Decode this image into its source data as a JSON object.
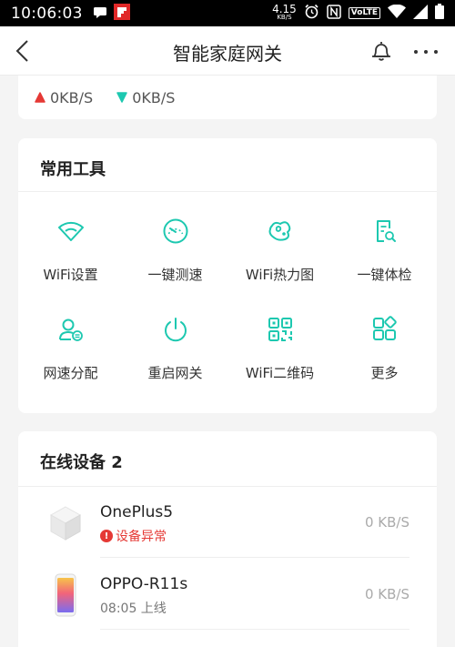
{
  "status_bar": {
    "time": "10:06:03",
    "net_speed_value": "4.15",
    "net_speed_unit": "KB/S",
    "volte_label": "VoLTE",
    "icons": [
      "chat-icon",
      "flipboard-icon",
      "alarm-icon",
      "nfc-icon",
      "volte-icon",
      "wifi-icon",
      "signal-icon",
      "battery-icon"
    ]
  },
  "header": {
    "title": "智能家庭网关",
    "icons": [
      "back-arrow-icon",
      "bell-icon",
      "more-icon"
    ]
  },
  "traffic": {
    "upload": "0KB/S",
    "download": "0KB/S",
    "upload_color": "#e53935",
    "download_color": "#1dc8b0"
  },
  "tools": {
    "title": "常用工具",
    "accent_color": "#1dc8b0",
    "items": [
      {
        "label": "WiFi设置",
        "icon": "wifi-icon"
      },
      {
        "label": "一键测速",
        "icon": "speedometer-icon"
      },
      {
        "label": "WiFi热力图",
        "icon": "heatmap-icon"
      },
      {
        "label": "一键体检",
        "icon": "checkup-icon"
      },
      {
        "label": "网速分配",
        "icon": "user-allocation-icon"
      },
      {
        "label": "重启网关",
        "icon": "power-icon"
      },
      {
        "label": "WiFi二维码",
        "icon": "qr-code-icon"
      },
      {
        "label": "更多",
        "icon": "grid-more-icon"
      }
    ]
  },
  "devices": {
    "title": "在线设备 2",
    "items": [
      {
        "name": "OnePlus5",
        "status": "设备异常",
        "status_type": "alert",
        "speed": "0 KB/S",
        "icon": "generic-device-icon"
      },
      {
        "name": "OPPO-R11s",
        "status": "08:05 上线",
        "status_type": "normal",
        "speed": "0 KB/S",
        "icon": "phone-icon"
      }
    ]
  }
}
